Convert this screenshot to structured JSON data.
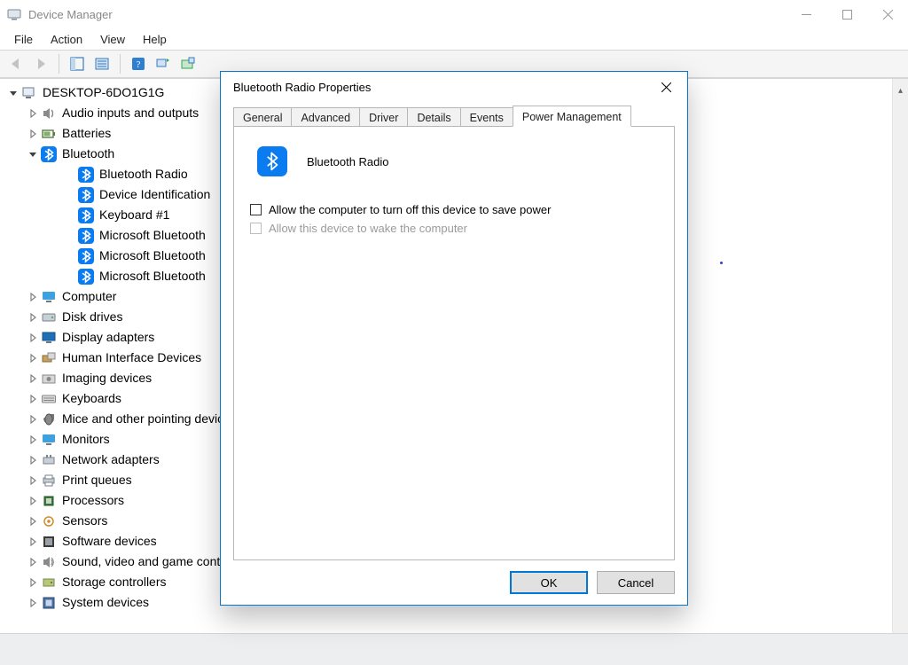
{
  "window": {
    "title": "Device Manager"
  },
  "menu": {
    "file": "File",
    "action": "Action",
    "view": "View",
    "help": "Help"
  },
  "tree": {
    "root": "DESKTOP-6DO1G1G",
    "items": [
      {
        "label": "Audio inputs and outputs",
        "icon": "speaker"
      },
      {
        "label": "Batteries",
        "icon": "battery"
      },
      {
        "label": "Bluetooth",
        "icon": "bt",
        "expanded": true,
        "children": [
          {
            "label": "Bluetooth Radio"
          },
          {
            "label": "Device Identification"
          },
          {
            "label": "Keyboard #1"
          },
          {
            "label": "Microsoft Bluetooth"
          },
          {
            "label": "Microsoft Bluetooth"
          },
          {
            "label": "Microsoft Bluetooth"
          }
        ]
      },
      {
        "label": "Computer",
        "icon": "monitor"
      },
      {
        "label": "Disk drives",
        "icon": "disk"
      },
      {
        "label": "Display adapters",
        "icon": "display"
      },
      {
        "label": "Human Interface Devices",
        "icon": "hid"
      },
      {
        "label": "Imaging devices",
        "icon": "imaging"
      },
      {
        "label": "Keyboards",
        "icon": "keyboard"
      },
      {
        "label": "Mice and other pointing devices",
        "icon": "mouse"
      },
      {
        "label": "Monitors",
        "icon": "monitor"
      },
      {
        "label": "Network adapters",
        "icon": "network"
      },
      {
        "label": "Print queues",
        "icon": "printer"
      },
      {
        "label": "Processors",
        "icon": "cpu"
      },
      {
        "label": "Sensors",
        "icon": "sensor"
      },
      {
        "label": "Software devices",
        "icon": "software"
      },
      {
        "label": "Sound, video and game controllers",
        "icon": "sound"
      },
      {
        "label": "Storage controllers",
        "icon": "storage"
      },
      {
        "label": "System devices",
        "icon": "system"
      }
    ]
  },
  "dialog": {
    "title": "Bluetooth Radio Properties",
    "tabs": {
      "general": "General",
      "advanced": "Advanced",
      "driver": "Driver",
      "details": "Details",
      "events": "Events",
      "power": "Power Management"
    },
    "device_name": "Bluetooth Radio",
    "opt1": "Allow the computer to turn off this device to save power",
    "opt2": "Allow this device to wake the computer",
    "ok": "OK",
    "cancel": "Cancel"
  }
}
